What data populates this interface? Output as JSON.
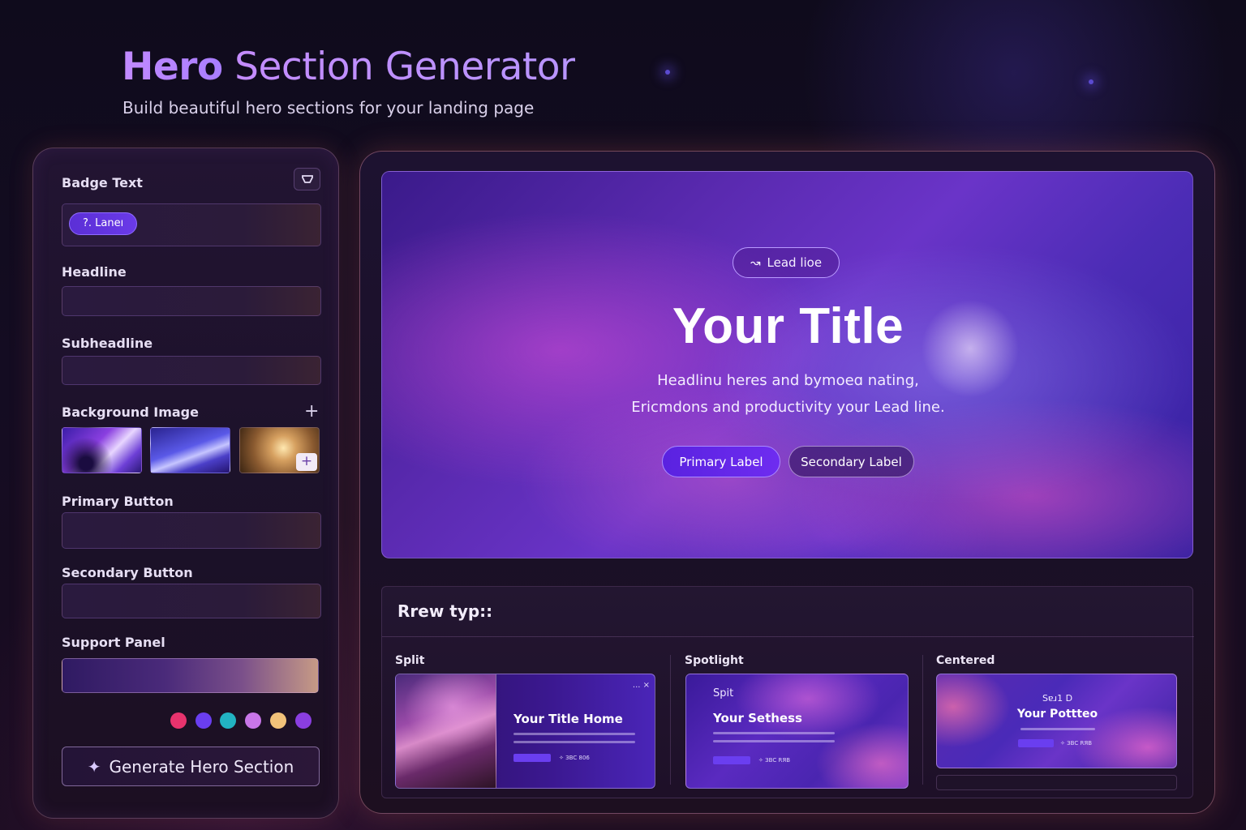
{
  "header": {
    "title_strong": "Hero",
    "title_rest": "Section Generator",
    "subtitle": "Build beautiful hero sections for your landing page"
  },
  "form": {
    "badge_label": "Badge Text",
    "badge_chip": "?. Laneı",
    "badge_icon": "collapse-icon",
    "headline_label": "Headline",
    "headline_value": "",
    "subheadline_label": "Subheadline",
    "subheadline_value": "",
    "background_label": "Background Image",
    "add_symbol": "+",
    "primary_label": "Primary Button",
    "primary_value": "",
    "secondary_label": "Secondary Button",
    "secondary_value": "",
    "support_label": "Support Panel",
    "colors": [
      "#e8336e",
      "#6a3ef0",
      "#22b3c2",
      "#c876e8",
      "#f2c27a",
      "#8a3ee0"
    ],
    "generate_label": "Generate Hero Section",
    "generate_icon": "sparkle-icon"
  },
  "preview": {
    "lead_pill": "Lead lioe",
    "lead_icon": "swirl-icon",
    "title": "Your Title",
    "sub_line1": "Headlinu heres and bymoeɑ nating,",
    "sub_line2": "Ericmdons and productivity your Lead line.",
    "primary_button": "Primary Label",
    "secondary_button": "Secondary Label"
  },
  "layouts": {
    "heading": "Rrew typ::",
    "items": [
      {
        "label": "Split",
        "card_title": "Your Title Home",
        "card_menu": "... ×",
        "card_link": "✧ ЗВС 806"
      },
      {
        "label": "Spotlight",
        "card_kicker": "Spit",
        "card_title": "Your Sethess",
        "card_link": "✧ ЗВС RЯВ"
      },
      {
        "label": "Centered",
        "card_kicker": "Sɐɹ1 D",
        "card_title": "Your Pottteo",
        "card_link": "✧ ЗВС RЯВ"
      }
    ]
  }
}
